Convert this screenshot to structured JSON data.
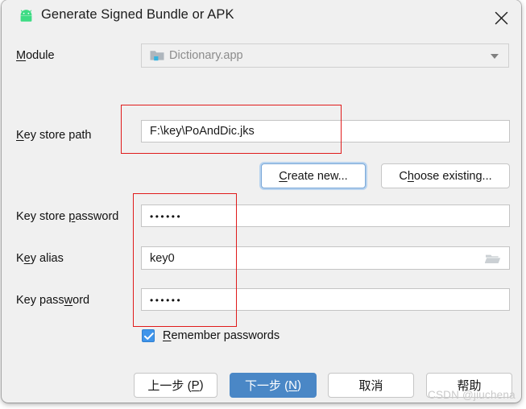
{
  "window": {
    "title": "Generate Signed Bundle or APK",
    "app_icon": "android-robot-icon",
    "close_label": "✕"
  },
  "form": {
    "module": {
      "label_pre": "",
      "label_mnemonic": "M",
      "label_post": "odule",
      "value": "Dictionary.app",
      "icon": "module-folder-icon",
      "dropdown_icon": "chevron-down-icon"
    },
    "key_store_path": {
      "label_mnemonic": "K",
      "label_post": "ey store path",
      "value": "F:\\key\\PoAndDic.jks"
    },
    "key_store_password": {
      "label_pre": "Key store ",
      "label_mnemonic": "p",
      "label_post": "assword",
      "value": "••••••"
    },
    "key_alias": {
      "label_pre": "K",
      "label_mnemonic": "e",
      "label_post": "y alias",
      "value": "key0",
      "browse_icon": "folder-browse-icon"
    },
    "key_password": {
      "label_pre": "Key pass",
      "label_mnemonic": "w",
      "label_post": "ord",
      "value": "••••••"
    },
    "remember": {
      "label_mnemonic": "R",
      "label_post": "emember passwords",
      "checked": true,
      "check_icon": "checkmark-icon"
    }
  },
  "buttons": {
    "create_new": {
      "pre": "",
      "mnemonic": "C",
      "post": "reate new..."
    },
    "choose_existing": {
      "pre": "C",
      "mnemonic": "h",
      "post": "oose existing..."
    },
    "previous": {
      "pre": "上一步 (",
      "mnemonic": "P",
      "post": ")"
    },
    "next": {
      "pre": "下一步 (",
      "mnemonic": "N",
      "post": ")"
    },
    "cancel": {
      "pre": "取消",
      "mnemonic": "",
      "post": ""
    },
    "help": {
      "pre": "帮助",
      "mnemonic": "",
      "post": ""
    }
  },
  "annotations": {
    "rect_keystore_path": "red-highlight-keystore-path",
    "rect_passwords": "red-highlight-credentials"
  },
  "watermark": "CSDN @jiuchena",
  "colors": {
    "accent_primary": "#4a87c6",
    "annotation_red": "#e01b1b",
    "android_green": "#3ddc84",
    "checkbox_blue": "#3f94ea",
    "dialog_bg": "#f0f0f0"
  }
}
